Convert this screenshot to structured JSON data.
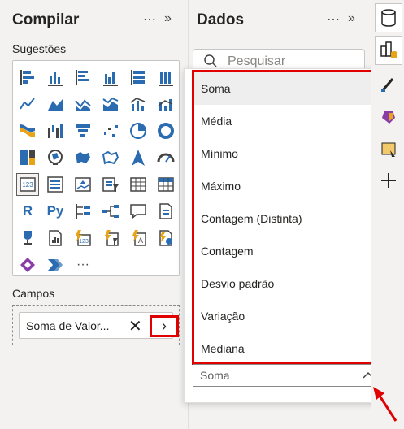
{
  "compilar": {
    "title": "Compilar",
    "more": "⋯",
    "collapse": "»",
    "suggestions_label": "Sugestões",
    "fields_label": "Campos",
    "field_chip": {
      "label": "Soma de Valor...",
      "remove": "✕",
      "expand": "›"
    },
    "viz_more": "···",
    "viz_r": "R",
    "viz_py": "Py"
  },
  "dados": {
    "title": "Dados",
    "more": "⋯",
    "collapse": "»",
    "search_placeholder": "Pesquisar"
  },
  "aggregation": {
    "options": [
      "Soma",
      "Média",
      "Mínimo",
      "Máximo",
      "Contagem (Distinta)",
      "Contagem",
      "Desvio padrão",
      "Variação",
      "Mediana"
    ],
    "selected": "Soma"
  },
  "colors": {
    "highlight_red": "#e00000",
    "accent_blue": "#2b6cb0"
  }
}
